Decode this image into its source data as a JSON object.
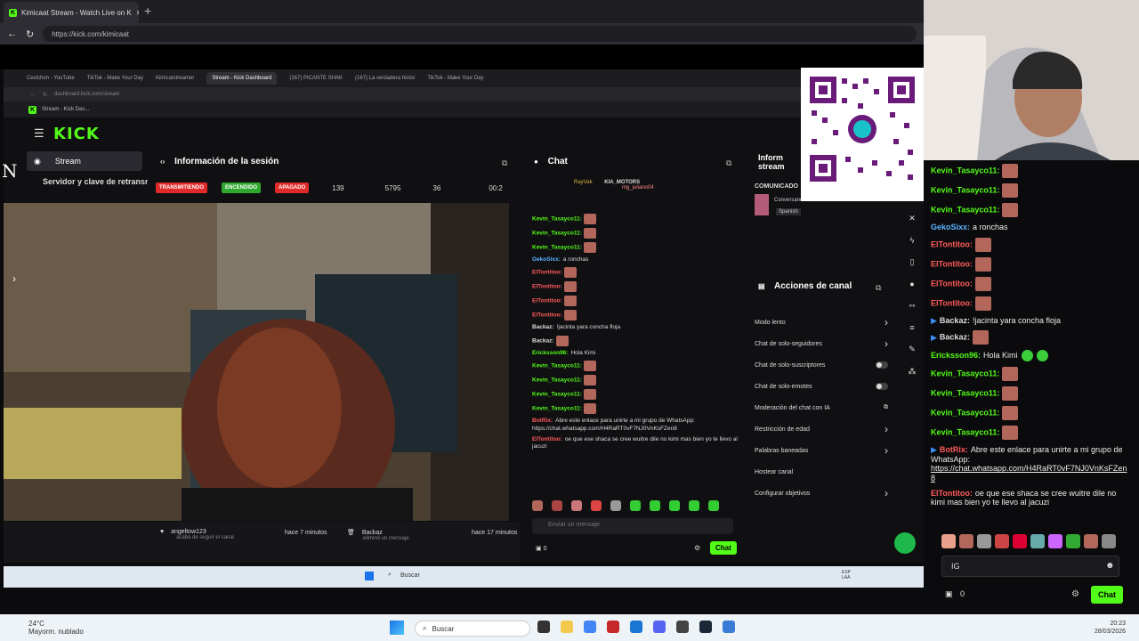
{
  "browser": {
    "tab_title": "Kimicaat Stream - Watch Live on K",
    "url": "https://kick.com/kimicaat"
  },
  "inner_browser": {
    "tabs": [
      "Cevichon - YouTube",
      "TikTok - Make Your Day",
      "Kimicatstreamer",
      "Stream - Kick Dashboard",
      "(167) PICANTE SHAK",
      "(167) La verdadera histor",
      "TikTok - Make Your Day"
    ],
    "url": "dashboard.kick.com/stream",
    "bookmark": "Stream - Kick Das..."
  },
  "dashboard": {
    "logo": "KICK",
    "nav_stream": "Stream",
    "nav_server": "Servidor y clave de retransn",
    "session_title": "Información de la sesión",
    "badges": [
      "TRANSMITIENDO",
      "ENCENDIDO",
      "APAGADO"
    ],
    "stats": [
      "139",
      "5795",
      "36",
      "00:2"
    ],
    "notif1_name": "angeltow123",
    "notif1_sub": "acaba de seguir el canal",
    "notif1_time": "hace 7 minutos",
    "notif2_name": "Backaz",
    "notif2_sub": "eliminó un mensaje",
    "notif2_time": "hace 17 minutos",
    "chat_title": "Chat",
    "pinned_user1": "RayVak",
    "pinned_user2": "KIA_MOTORS",
    "pinned_user3": "mg_juliano04",
    "mid_chat": [
      {
        "user": "Kevin_Tasayco11:",
        "text": "",
        "color": "#53fc18",
        "emote": true
      },
      {
        "user": "Kevin_Tasayco11:",
        "text": "",
        "color": "#53fc18",
        "emote": true
      },
      {
        "user": "Kevin_Tasayco11:",
        "text": "",
        "color": "#53fc18",
        "emote": true
      },
      {
        "user": "GekoSixx:",
        "text": "a ronchas",
        "color": "#5ab4ff",
        "emote": false
      },
      {
        "user": "ElTontitoo:",
        "text": "",
        "color": "#ff5a5a",
        "emote": true
      },
      {
        "user": "ElTontitoo:",
        "text": "",
        "color": "#ff5a5a",
        "emote": true
      },
      {
        "user": "ElTontitoo:",
        "text": "",
        "color": "#ff5a5a",
        "emote": true
      },
      {
        "user": "ElTontitoo:",
        "text": "",
        "color": "#ff5a5a",
        "emote": true
      },
      {
        "user": "Backaz:",
        "text": "!jacinta yara concha floja",
        "color": "#ddd",
        "emote": false
      },
      {
        "user": "Backaz:",
        "text": "",
        "color": "#ddd",
        "emote": true
      },
      {
        "user": "Ericksson96:",
        "text": "Hola Kimi",
        "color": "#53fc18",
        "emote": false
      },
      {
        "user": "Kevin_Tasayco11:",
        "text": "",
        "color": "#53fc18",
        "emote": true
      },
      {
        "user": "Kevin_Tasayco11:",
        "text": "",
        "color": "#53fc18",
        "emote": true
      },
      {
        "user": "Kevin_Tasayco11:",
        "text": "",
        "color": "#53fc18",
        "emote": true
      },
      {
        "user": "Kevin_Tasayco11:",
        "text": "",
        "color": "#53fc18",
        "emote": true
      },
      {
        "user": "BotRix:",
        "text": "Abre este enlace para unirte a mi grupo de WhatsApp: https://chat.whatsapp.com/H4RaRT0vF7NJ0VnKsFZen8",
        "color": "#ff5a5a",
        "emote": false
      },
      {
        "user": "ElTontitoo:",
        "text": "oe que ese shaca se cree wuitre dile no kimi mas bien yo te llevo al jacuzi",
        "color": "#ff5a5a",
        "emote": false
      }
    ],
    "mid_input_placeholder": "Enviar un mensaje",
    "mid_gift_count": "0",
    "mid_chat_button": "Chat",
    "side_title": "Inform stream",
    "comm_title": "COMUNICADO",
    "comm_text1": "Conversando",
    "comm_text2": "Spanish",
    "actions_title": "Acciones de canal",
    "actions": [
      {
        "label": "Modo lento",
        "control": "chevron"
      },
      {
        "label": "Chat de solo-seguidores",
        "control": "chevron"
      },
      {
        "label": "Chat de solo-suscriptores",
        "control": "toggle"
      },
      {
        "label": "Chat de solo-emotes",
        "control": "toggle"
      },
      {
        "label": "Moderación del chat con IA",
        "control": "link"
      },
      {
        "label": "Restricción de edad",
        "control": "chevron"
      },
      {
        "label": "Palabras baneadas",
        "control": "chevron"
      },
      {
        "label": "Hostear canal",
        "control": "none"
      },
      {
        "label": "Configurar objetivos",
        "control": "chevron"
      }
    ]
  },
  "inner_taskbar": {
    "search": "Buscar",
    "lang": "ESP LAA"
  },
  "right_chat": [
    {
      "user": "Kevin_Tasayco11:",
      "text": "",
      "color": "#53fc18",
      "emote": true
    },
    {
      "user": "Kevin_Tasayco11:",
      "text": "",
      "color": "#53fc18",
      "emote": true
    },
    {
      "user": "Kevin_Tasayco11:",
      "text": "",
      "color": "#53fc18",
      "emote": true
    },
    {
      "user": "GekoSixx:",
      "text": "a ronchas",
      "color": "#5ab4ff",
      "emote": false
    },
    {
      "user": "ElTontitoo:",
      "text": "",
      "color": "#ff5a5a",
      "emote": true
    },
    {
      "user": "ElTontitoo:",
      "text": "",
      "color": "#ff5a5a",
      "emote": true
    },
    {
      "user": "ElTontitoo:",
      "text": "",
      "color": "#ff5a5a",
      "emote": true
    },
    {
      "user": "ElTontitoo:",
      "text": "",
      "color": "#ff5a5a",
      "emote": true
    },
    {
      "user": "Backaz:",
      "text": "!jacinta yara concha floja",
      "color": "#ddd",
      "emote": false
    },
    {
      "user": "Backaz:",
      "text": "",
      "color": "#ddd",
      "emote": true
    },
    {
      "user": "Ericksson96:",
      "text": "Hola Kimi",
      "color": "#53fc18",
      "emote": false,
      "greens": true
    },
    {
      "user": "Kevin_Tasayco11:",
      "text": "",
      "color": "#53fc18",
      "emote": true
    },
    {
      "user": "Kevin_Tasayco11:",
      "text": "",
      "color": "#53fc18",
      "emote": true
    },
    {
      "user": "Kevin_Tasayco11:",
      "text": "",
      "color": "#53fc18",
      "emote": true
    },
    {
      "user": "Kevin_Tasayco11:",
      "text": "",
      "color": "#53fc18",
      "emote": true
    },
    {
      "user": "BotRix:",
      "text": "Abre este enlace para unirte a mi grupo de WhatsApp:",
      "link": "https://chat.whatsapp.com/H4RaRT0vF7NJ0VnKsFZen8",
      "color": "#ff5a5a",
      "emote": false
    },
    {
      "user": "ElTontitoo:",
      "text": "oe que ese shaca se cree wuitre dile no kimi mas bien yo te llevo al jacuzi",
      "color": "#ff5a5a",
      "emote": false
    }
  ],
  "right_input_value": "IG",
  "right_gift_count": "0",
  "right_chat_button": "Chat",
  "os": {
    "weather_temp": "24°C",
    "weather_desc": "Mayorm. nublado",
    "search": "Buscar",
    "time": "20:23",
    "date": "28/03/2026"
  },
  "colors": {
    "kick_green": "#53fc18"
  }
}
